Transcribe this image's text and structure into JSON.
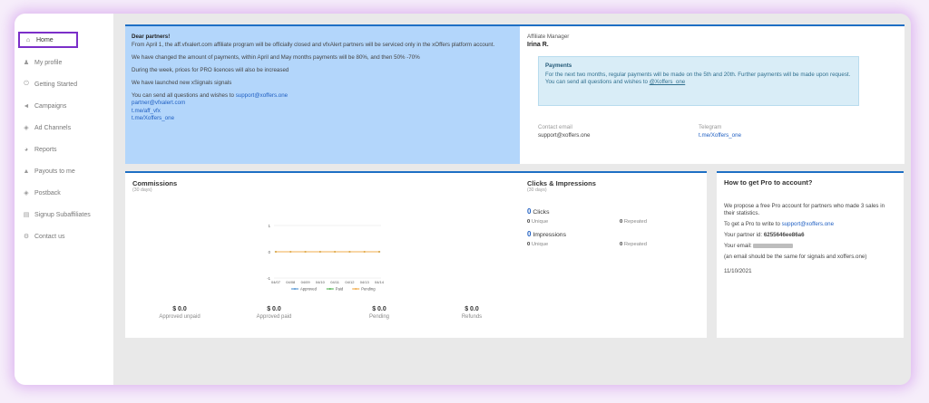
{
  "sidebar": {
    "items": [
      {
        "label": "Home",
        "icon": "home-icon"
      },
      {
        "label": "My profile",
        "icon": "user-icon"
      },
      {
        "label": "Getting Started",
        "icon": "power-icon"
      },
      {
        "label": "Campaigns",
        "icon": "bullhorn-icon"
      },
      {
        "label": "Ad Channels",
        "icon": "satellite-icon"
      },
      {
        "label": "Reports",
        "icon": "pie-chart-icon"
      },
      {
        "label": "Payouts to me",
        "icon": "money-bag-icon"
      },
      {
        "label": "Postback",
        "icon": "satellite-icon"
      },
      {
        "label": "Signup Subaffiliates",
        "icon": "id-card-icon"
      },
      {
        "label": "Contact us",
        "icon": "gear-icon"
      }
    ]
  },
  "notice": {
    "title": "Dear partners!",
    "p1": "From April 1, the aff.vfxalert.com affiliate program will be officially closed and vfxAlert partners will be serviced only in the xOffers platform account.",
    "p2": "We have changed the amount of payments, within April and May months payments will be 80%, and then 50% -70%",
    "p3": "During the week, prices for PRO licences will also be increased",
    "p4": "We have launched new xSignals signals",
    "p5": "You can send all questions and wishes to",
    "email1": "support@xoffers.one",
    "email2": "partner@vfxalert.com",
    "tg1": "t.me/aff_vfx",
    "tg2": "t.me/Xoffers_one"
  },
  "manager": {
    "label": "Affiliate Manager",
    "name": "Irina R.",
    "payments_title": "Payments",
    "payments_text": "For the next two months, regular payments will be made on the 5th and 20th. Further payments will be made upon request.",
    "payments_text2": "You can send all questions and wishes to",
    "payments_link": "@Xoffers_one",
    "email_label": "Contact email",
    "email_value": "support@xoffers.one",
    "tg_label": "Telegram",
    "tg_value": "t.me/Xoffers_one"
  },
  "commissions": {
    "title": "Commissions",
    "subtitle": "(30 days)",
    "totals": [
      {
        "amount": "$ 0.0",
        "label": "Approved unpaid"
      },
      {
        "amount": "$ 0.0",
        "label": "Approved paid"
      },
      {
        "amount": "$ 0.0",
        "label": "Pending"
      },
      {
        "amount": "$ 0.0",
        "label": "Refunds"
      }
    ]
  },
  "chart_data": {
    "type": "line",
    "categories": [
      "04/07",
      "04/08",
      "04/09",
      "04/10",
      "04/11",
      "04/12",
      "04/13",
      "04/14"
    ],
    "yticks": [
      "1",
      "0",
      "-1"
    ],
    "ylim": [
      -1,
      1
    ],
    "series": [
      {
        "name": "Approved",
        "color": "#5b9bd5",
        "values": [
          0,
          0,
          0,
          0,
          0,
          0,
          0,
          0
        ]
      },
      {
        "name": "Paid",
        "color": "#5cb85c",
        "values": [
          0,
          0,
          0,
          0,
          0,
          0,
          0,
          0
        ]
      },
      {
        "name": "Pending",
        "color": "#f0ad4e",
        "values": [
          0,
          0,
          0,
          0,
          0,
          0,
          0,
          0
        ]
      }
    ]
  },
  "clicks": {
    "title": "Clicks & Impressions",
    "subtitle": "(30 days)",
    "clicks_count": "0",
    "clicks_label": "Clicks",
    "impressions_count": "0",
    "impressions_label": "Impressions",
    "unique_count": "0",
    "unique_label": "Unique",
    "repeated_count": "0",
    "repeated_label": "Repeated"
  },
  "howto": {
    "title": "How to get Pro to account?",
    "p1": "We propose a free Pro account for partners who made 3 sales in their statistics.",
    "p2": "To get a Pro to write to",
    "email": "support@xoffers.one",
    "id_label": "Your partner id:",
    "id_value": "6255646ee86a6",
    "email_label": "Your email:",
    "note": "(an email should be the same for signals and xoffers.one)",
    "date": "11/10/2021"
  }
}
